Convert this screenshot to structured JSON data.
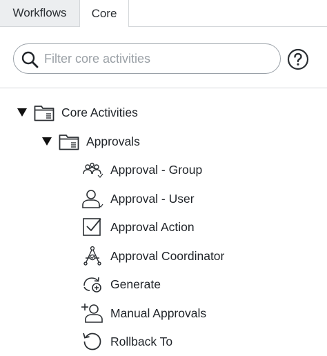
{
  "tabs": [
    {
      "label": "Workflows",
      "selected": false
    },
    {
      "label": "Core",
      "selected": true
    }
  ],
  "search": {
    "placeholder": "Filter core activities",
    "value": ""
  },
  "help": {
    "icon": "question-circle-icon"
  },
  "tree": {
    "root": {
      "label": "Core Activities",
      "expanded": true,
      "icon": "folder-icon"
    },
    "group": {
      "label": "Approvals",
      "expanded": true,
      "icon": "folder-icon"
    },
    "activities": [
      {
        "label": "Approval - Group",
        "icon": "approval-group-icon"
      },
      {
        "label": "Approval - User",
        "icon": "approval-user-icon"
      },
      {
        "label": "Approval Action",
        "icon": "checkbox-icon"
      },
      {
        "label": "Approval Coordinator",
        "icon": "coordinator-icon"
      },
      {
        "label": "Generate",
        "icon": "generate-icon"
      },
      {
        "label": "Manual Approvals",
        "icon": "add-user-icon"
      },
      {
        "label": "Rollback To",
        "icon": "rollback-icon"
      }
    ]
  },
  "colors": {
    "border": "#d4d7da",
    "inactive_tab": "#eceef0",
    "text": "#1f2328",
    "icon": "#2b2f33"
  }
}
